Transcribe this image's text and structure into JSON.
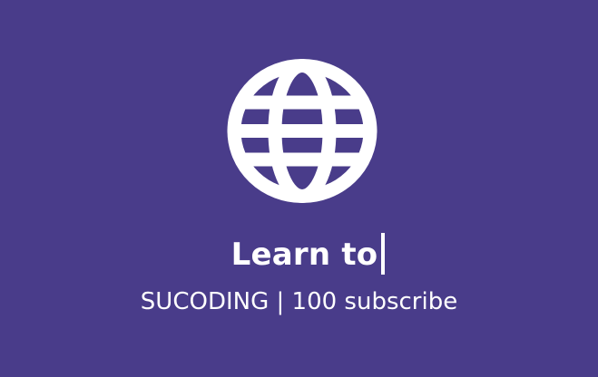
{
  "icon": "globe-icon",
  "colors": {
    "background": "#493c8a",
    "foreground": "#ffffff"
  },
  "headline": {
    "text": "Learn to"
  },
  "subline": {
    "text": "SUCODING | 100 subscribe"
  }
}
